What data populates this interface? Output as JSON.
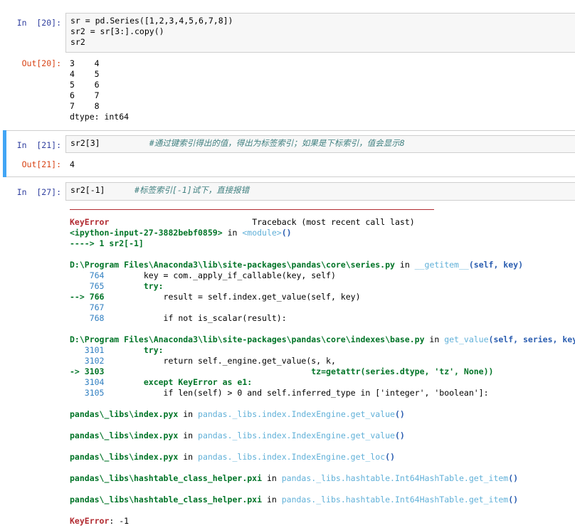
{
  "cell20": {
    "in_prompt": "In  [20]:",
    "code_lines": [
      "sr = pd.Series([1,2,3,4,5,6,7,8])",
      "sr2 = sr[3:].copy()",
      "sr2"
    ],
    "out_prompt": "Out[20]:",
    "output_lines": [
      "3    4",
      "4    5",
      "5    6",
      "6    7",
      "7    8",
      "dtype: int64"
    ]
  },
  "cell21": {
    "in_prompt": "In  [21]:",
    "code": "sr2[3]",
    "comment": "#通过键索引得出的值，得出为标签索引；如果是下标索引，值会显示8",
    "out_prompt": "Out[21]:",
    "output": "4"
  },
  "cell27": {
    "in_prompt": "In  [27]:",
    "code": "sr2[-1]",
    "comment": "#标签索引[-1]试下，直接报错"
  },
  "traceback": {
    "error_name": "KeyError",
    "header_right": "Traceback (most recent call last)",
    "input_frame": "<ipython-input-27-3882bebf0859>",
    "input_in": " in ",
    "input_module": "<module>",
    "input_paren": "()",
    "input_arrow_line": "----> 1 sr2[-1]",
    "frame1_path": "D:\\Program Files\\Anaconda3\\lib\\site-packages\\pandas\\core\\series.py",
    "frame1_in": " in ",
    "frame1_func": "__getitem__",
    "frame1_args": "(self, key)",
    "frame1_lines": [
      {
        "no": "    764",
        "code": "        key = com._apply_if_callable(key, self)"
      },
      {
        "no": "    765",
        "code": "        try:"
      },
      {
        "no": "--> 766",
        "code": "            result = self.index.get_value(self, key)"
      },
      {
        "no": "    767",
        "code": ""
      },
      {
        "no": "    768",
        "code": "            if not is_scalar(result):"
      }
    ],
    "frame2_path": "D:\\Program Files\\Anaconda3\\lib\\site-packages\\pandas\\core\\indexes\\base.py",
    "frame2_in": " in ",
    "frame2_func": "get_value",
    "frame2_args": "(self, series, key)",
    "frame2_lines": [
      {
        "no": "   3101",
        "code": "        try:"
      },
      {
        "no": "   3102",
        "code": "            return self._engine.get_value(s, k,"
      },
      {
        "no": "-> 3103",
        "code": "                                          tz=getattr(series.dtype, 'tz', None))"
      },
      {
        "no": "   3104",
        "code": "        except KeyError as e1:"
      },
      {
        "no": "   3105",
        "code": "            if len(self) > 0 and self.inferred_type in ['integer', 'boolean']:"
      }
    ],
    "frames": [
      {
        "file": "pandas\\_libs\\index.pyx",
        "in": " in ",
        "func": "pandas._libs.index.IndexEngine.get_value",
        "paren": "()"
      },
      {
        "file": "pandas\\_libs\\index.pyx",
        "in": " in ",
        "func": "pandas._libs.index.IndexEngine.get_value",
        "paren": "()"
      },
      {
        "file": "pandas\\_libs\\index.pyx",
        "in": " in ",
        "func": "pandas._libs.index.IndexEngine.get_loc",
        "paren": "()"
      },
      {
        "file": "pandas\\_libs\\hashtable_class_helper.pxi",
        "in": " in ",
        "func": "pandas._libs.hashtable.Int64HashTable.get_item",
        "paren": "()"
      },
      {
        "file": "pandas\\_libs\\hashtable_class_helper.pxi",
        "in": " in ",
        "func": "pandas._libs.hashtable.Int64HashTable.get_item",
        "paren": "()"
      }
    ],
    "final_error": "KeyError",
    "final_msg": ": -1"
  }
}
